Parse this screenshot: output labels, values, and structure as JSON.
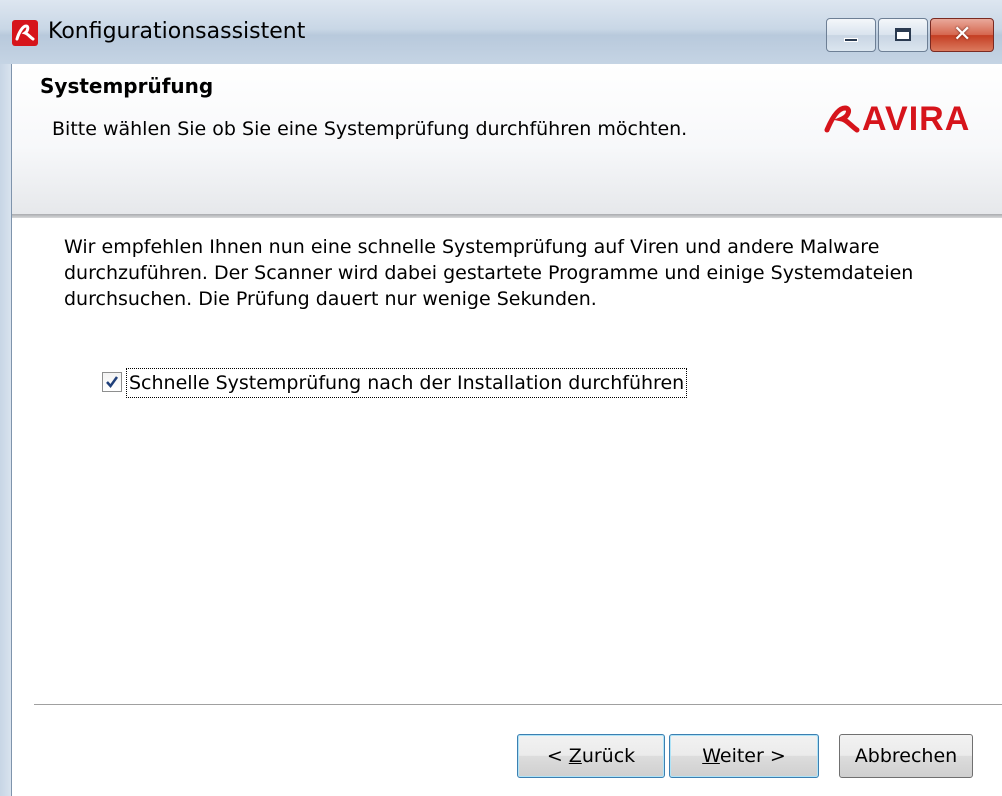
{
  "window": {
    "title": "Konfigurationsassistent",
    "controls": {
      "minimize": "–",
      "maximize": "□",
      "close": "✕"
    }
  },
  "header": {
    "title": "Systemprüfung",
    "subtitle": "Bitte wählen Sie ob Sie eine Systemprüfung durchführen möchten.",
    "logo_text": "AVIRA",
    "brand_color": "#d6141b"
  },
  "body": {
    "paragraph_lines": [
      "Wir empfehlen Ihnen nun eine schnelle Systemprüfung auf Viren und andere Malware",
      "durchzuführen. Der Scanner wird dabei gestartete Programme und einige Systemdateien",
      "durchsuchen. Die Prüfung dauert nur wenige Sekunden."
    ],
    "checkbox": {
      "label": "Schnelle Systemprüfung nach der Installation durchführen",
      "checked": true
    }
  },
  "buttons": {
    "back": {
      "prefix": "< ",
      "mnemonic": "Z",
      "rest": "urück"
    },
    "next": {
      "mnemonic": "W",
      "rest": "eiter >"
    },
    "cancel": "Abbrechen"
  }
}
